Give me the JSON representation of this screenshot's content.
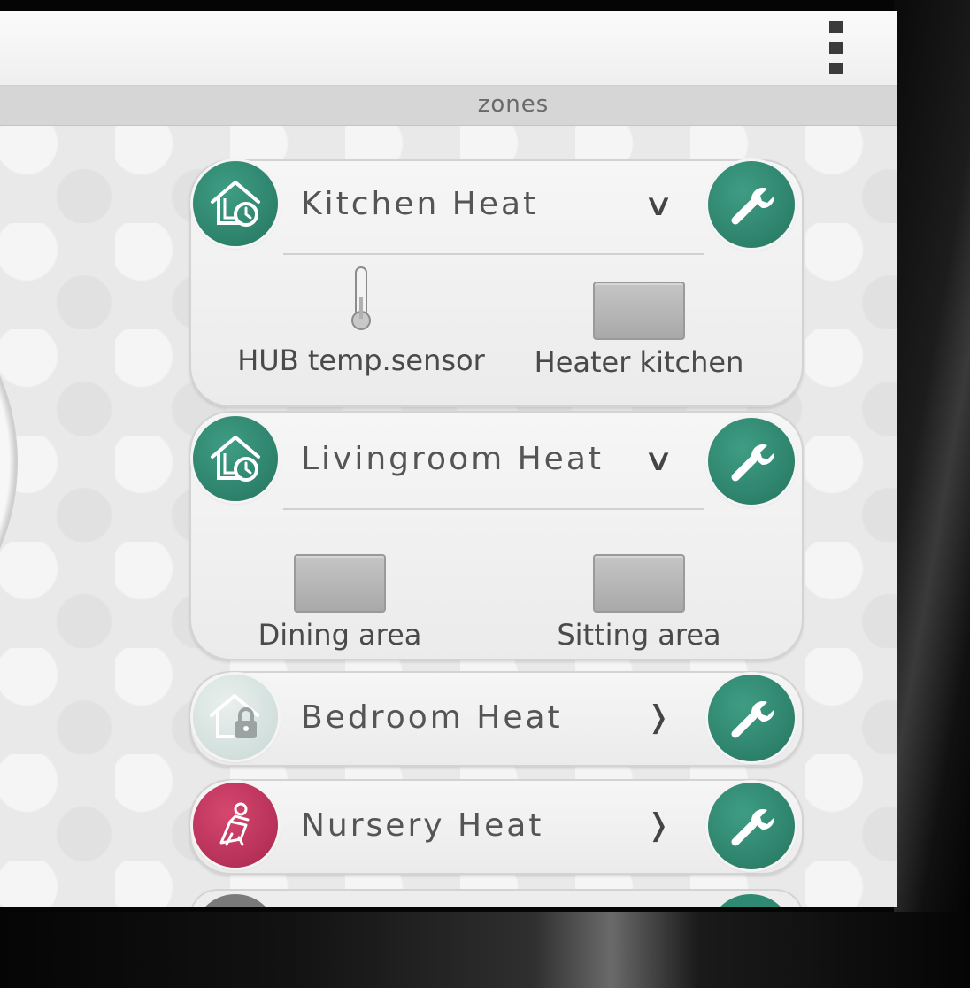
{
  "header": {
    "section_title": "zones"
  },
  "zones": [
    {
      "name": "Kitchen Heat",
      "state": "expanded",
      "chevron": "∨",
      "mode_icon": "home-clock-icon",
      "devices": [
        {
          "label": "HUB temp.sensor",
          "icon": "thermometer-icon"
        },
        {
          "label": "Heater kitchen",
          "icon": "heater-icon"
        }
      ]
    },
    {
      "name": "Livingroom Heat",
      "state": "expanded",
      "chevron": "∨",
      "mode_icon": "home-clock-icon",
      "devices": [
        {
          "label": "Dining area",
          "icon": "heater-icon"
        },
        {
          "label": "Sitting area",
          "icon": "heater-icon"
        }
      ]
    },
    {
      "name": "Bedroom Heat",
      "state": "collapsed",
      "chevron": "❭",
      "mode_icon": "home-lock-icon"
    },
    {
      "name": "Nursery Heat",
      "state": "collapsed",
      "chevron": "❭",
      "mode_icon": "relax-chair-icon"
    }
  ],
  "colors": {
    "accent_green": "#2f8a72",
    "accent_pink": "#c0365e",
    "text": "#555555"
  }
}
